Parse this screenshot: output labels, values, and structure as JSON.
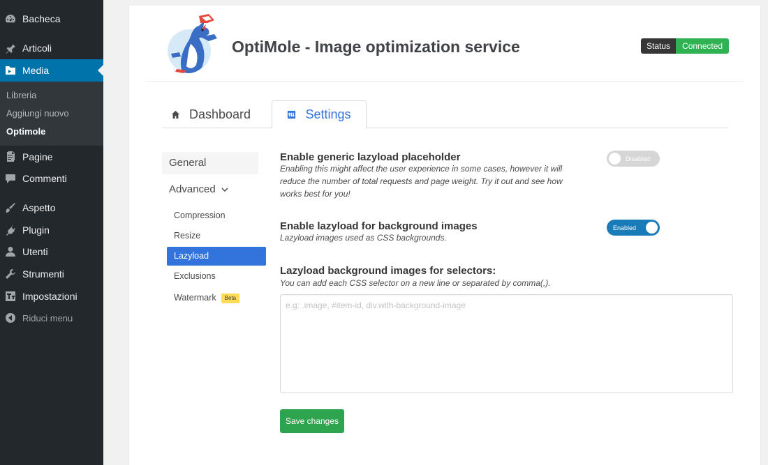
{
  "sidebar": {
    "items": [
      {
        "label": "Bacheca",
        "icon": "dashboard-icon"
      },
      {
        "label": "Articoli",
        "icon": "pin-icon"
      },
      {
        "label": "Media",
        "icon": "media-icon"
      },
      {
        "label": "Pagine",
        "icon": "pages-icon"
      },
      {
        "label": "Commenti",
        "icon": "comments-icon"
      },
      {
        "label": "Aspetto",
        "icon": "brush-icon"
      },
      {
        "label": "Plugin",
        "icon": "plugin-icon"
      },
      {
        "label": "Utenti",
        "icon": "users-icon"
      },
      {
        "label": "Strumenti",
        "icon": "tools-icon"
      },
      {
        "label": "Impostazioni",
        "icon": "settings-icon"
      }
    ],
    "media_submenu": [
      "Libreria",
      "Aggiungi nuovo",
      "Optimole"
    ],
    "collapse_label": "Riduci menu",
    "active_color": "#0073aa"
  },
  "header": {
    "title": "OptiMole - Image optimization service",
    "status_label": "Status",
    "status_value": "Connected",
    "status_color": "#2ea44f"
  },
  "tabs": [
    {
      "label": "Dashboard",
      "icon": "home-icon"
    },
    {
      "label": "Settings",
      "icon": "settings-grid-icon",
      "active": true
    }
  ],
  "settings_nav": {
    "general": "General",
    "advanced": "Advanced",
    "sub_items": [
      "Compression",
      "Resize",
      "Lazyload",
      "Exclusions",
      "Watermark"
    ],
    "active_item": "Lazyload",
    "beta_badge": "Beta"
  },
  "options": {
    "generic_placeholder": {
      "title": "Enable generic lazyload placeholder",
      "description_lines": [
        "Enabling this might affect the user experience in some cases, however it will",
        "reduce the number of total requests and page weight. Try it out and see how",
        "works best for you!"
      ],
      "toggle_label": "Disabled",
      "enabled": false
    },
    "background_images": {
      "title": "Enable lazyload for background images",
      "description": "Lazyload images used as CSS backgrounds.",
      "toggle_label": "Enabled",
      "enabled": true
    },
    "selectors": {
      "title": "Lazyload background images for selectors:",
      "description": "You can add each CSS selector on a new line or separated by comma(,).",
      "placeholder": "e.g: .image, #item-id, div.with-background-image",
      "value": ""
    }
  },
  "save_label": "Save changes"
}
